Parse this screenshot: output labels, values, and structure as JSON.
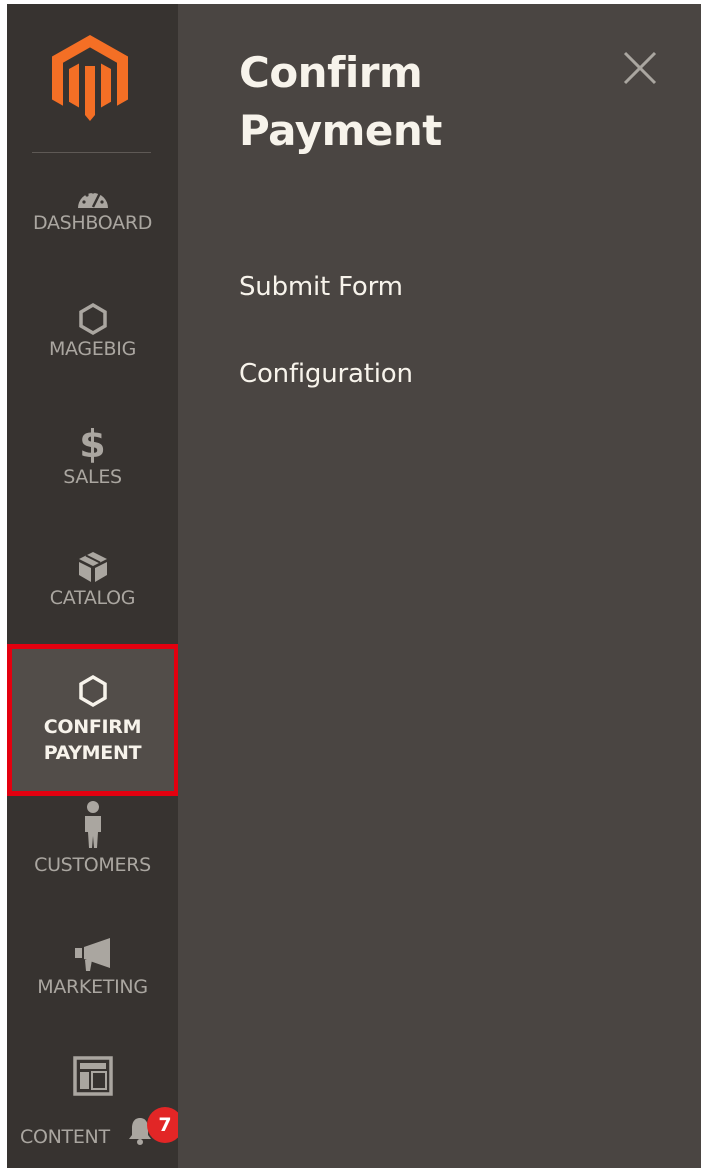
{
  "sidebar": {
    "items": [
      {
        "label": "DASHBOARD",
        "icon": "gauge-icon"
      },
      {
        "label": "MAGEBIG",
        "icon": "hexagon-icon"
      },
      {
        "label": "SALES",
        "icon": "dollar-icon"
      },
      {
        "label": "CATALOG",
        "icon": "box-icon"
      },
      {
        "label": "CONFIRM\nPAYMENT",
        "icon": "hexagon-icon"
      },
      {
        "label": "CUSTOMERS",
        "icon": "person-icon"
      },
      {
        "label": "MARKETING",
        "icon": "megaphone-icon"
      },
      {
        "label": "CONTENT",
        "icon": "layout-icon"
      }
    ],
    "notification_count": "7"
  },
  "panel": {
    "title": "Confirm Payment",
    "links": [
      "Submit Form",
      "Configuration"
    ]
  },
  "colors": {
    "sidebar_bg": "#373330",
    "panel_bg": "#4a4542",
    "active_bg": "#524d49",
    "brand_orange": "#f46f25",
    "highlight_red": "#e3000f",
    "badge_red": "#e22626"
  }
}
